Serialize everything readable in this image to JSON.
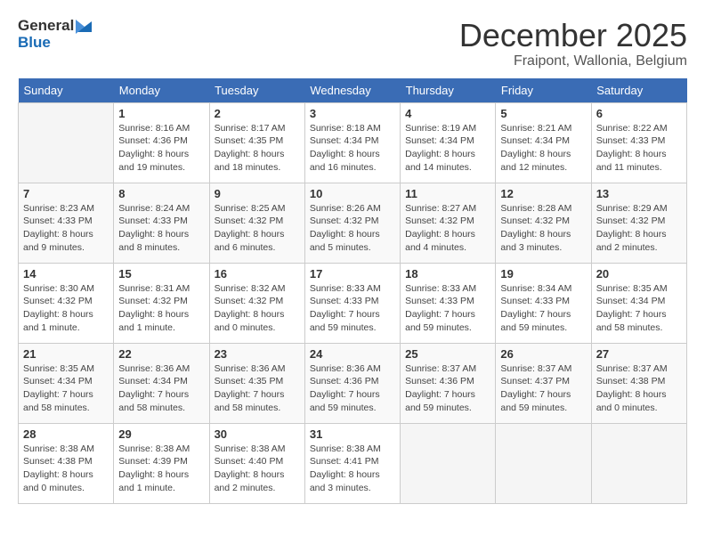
{
  "header": {
    "logo_general": "General",
    "logo_blue": "Blue",
    "month_year": "December 2025",
    "location": "Fraipont, Wallonia, Belgium"
  },
  "days_of_week": [
    "Sunday",
    "Monday",
    "Tuesday",
    "Wednesday",
    "Thursday",
    "Friday",
    "Saturday"
  ],
  "weeks": [
    [
      {
        "day": "",
        "sunrise": "",
        "sunset": "",
        "daylight": ""
      },
      {
        "day": "1",
        "sunrise": "Sunrise: 8:16 AM",
        "sunset": "Sunset: 4:36 PM",
        "daylight": "Daylight: 8 hours and 19 minutes."
      },
      {
        "day": "2",
        "sunrise": "Sunrise: 8:17 AM",
        "sunset": "Sunset: 4:35 PM",
        "daylight": "Daylight: 8 hours and 18 minutes."
      },
      {
        "day": "3",
        "sunrise": "Sunrise: 8:18 AM",
        "sunset": "Sunset: 4:34 PM",
        "daylight": "Daylight: 8 hours and 16 minutes."
      },
      {
        "day": "4",
        "sunrise": "Sunrise: 8:19 AM",
        "sunset": "Sunset: 4:34 PM",
        "daylight": "Daylight: 8 hours and 14 minutes."
      },
      {
        "day": "5",
        "sunrise": "Sunrise: 8:21 AM",
        "sunset": "Sunset: 4:34 PM",
        "daylight": "Daylight: 8 hours and 12 minutes."
      },
      {
        "day": "6",
        "sunrise": "Sunrise: 8:22 AM",
        "sunset": "Sunset: 4:33 PM",
        "daylight": "Daylight: 8 hours and 11 minutes."
      }
    ],
    [
      {
        "day": "7",
        "sunrise": "Sunrise: 8:23 AM",
        "sunset": "Sunset: 4:33 PM",
        "daylight": "Daylight: 8 hours and 9 minutes."
      },
      {
        "day": "8",
        "sunrise": "Sunrise: 8:24 AM",
        "sunset": "Sunset: 4:33 PM",
        "daylight": "Daylight: 8 hours and 8 minutes."
      },
      {
        "day": "9",
        "sunrise": "Sunrise: 8:25 AM",
        "sunset": "Sunset: 4:32 PM",
        "daylight": "Daylight: 8 hours and 6 minutes."
      },
      {
        "day": "10",
        "sunrise": "Sunrise: 8:26 AM",
        "sunset": "Sunset: 4:32 PM",
        "daylight": "Daylight: 8 hours and 5 minutes."
      },
      {
        "day": "11",
        "sunrise": "Sunrise: 8:27 AM",
        "sunset": "Sunset: 4:32 PM",
        "daylight": "Daylight: 8 hours and 4 minutes."
      },
      {
        "day": "12",
        "sunrise": "Sunrise: 8:28 AM",
        "sunset": "Sunset: 4:32 PM",
        "daylight": "Daylight: 8 hours and 3 minutes."
      },
      {
        "day": "13",
        "sunrise": "Sunrise: 8:29 AM",
        "sunset": "Sunset: 4:32 PM",
        "daylight": "Daylight: 8 hours and 2 minutes."
      }
    ],
    [
      {
        "day": "14",
        "sunrise": "Sunrise: 8:30 AM",
        "sunset": "Sunset: 4:32 PM",
        "daylight": "Daylight: 8 hours and 1 minute."
      },
      {
        "day": "15",
        "sunrise": "Sunrise: 8:31 AM",
        "sunset": "Sunset: 4:32 PM",
        "daylight": "Daylight: 8 hours and 1 minute."
      },
      {
        "day": "16",
        "sunrise": "Sunrise: 8:32 AM",
        "sunset": "Sunset: 4:32 PM",
        "daylight": "Daylight: 8 hours and 0 minutes."
      },
      {
        "day": "17",
        "sunrise": "Sunrise: 8:33 AM",
        "sunset": "Sunset: 4:33 PM",
        "daylight": "Daylight: 7 hours and 59 minutes."
      },
      {
        "day": "18",
        "sunrise": "Sunrise: 8:33 AM",
        "sunset": "Sunset: 4:33 PM",
        "daylight": "Daylight: 7 hours and 59 minutes."
      },
      {
        "day": "19",
        "sunrise": "Sunrise: 8:34 AM",
        "sunset": "Sunset: 4:33 PM",
        "daylight": "Daylight: 7 hours and 59 minutes."
      },
      {
        "day": "20",
        "sunrise": "Sunrise: 8:35 AM",
        "sunset": "Sunset: 4:34 PM",
        "daylight": "Daylight: 7 hours and 58 minutes."
      }
    ],
    [
      {
        "day": "21",
        "sunrise": "Sunrise: 8:35 AM",
        "sunset": "Sunset: 4:34 PM",
        "daylight": "Daylight: 7 hours and 58 minutes."
      },
      {
        "day": "22",
        "sunrise": "Sunrise: 8:36 AM",
        "sunset": "Sunset: 4:34 PM",
        "daylight": "Daylight: 7 hours and 58 minutes."
      },
      {
        "day": "23",
        "sunrise": "Sunrise: 8:36 AM",
        "sunset": "Sunset: 4:35 PM",
        "daylight": "Daylight: 7 hours and 58 minutes."
      },
      {
        "day": "24",
        "sunrise": "Sunrise: 8:36 AM",
        "sunset": "Sunset: 4:36 PM",
        "daylight": "Daylight: 7 hours and 59 minutes."
      },
      {
        "day": "25",
        "sunrise": "Sunrise: 8:37 AM",
        "sunset": "Sunset: 4:36 PM",
        "daylight": "Daylight: 7 hours and 59 minutes."
      },
      {
        "day": "26",
        "sunrise": "Sunrise: 8:37 AM",
        "sunset": "Sunset: 4:37 PM",
        "daylight": "Daylight: 7 hours and 59 minutes."
      },
      {
        "day": "27",
        "sunrise": "Sunrise: 8:37 AM",
        "sunset": "Sunset: 4:38 PM",
        "daylight": "Daylight: 8 hours and 0 minutes."
      }
    ],
    [
      {
        "day": "28",
        "sunrise": "Sunrise: 8:38 AM",
        "sunset": "Sunset: 4:38 PM",
        "daylight": "Daylight: 8 hours and 0 minutes."
      },
      {
        "day": "29",
        "sunrise": "Sunrise: 8:38 AM",
        "sunset": "Sunset: 4:39 PM",
        "daylight": "Daylight: 8 hours and 1 minute."
      },
      {
        "day": "30",
        "sunrise": "Sunrise: 8:38 AM",
        "sunset": "Sunset: 4:40 PM",
        "daylight": "Daylight: 8 hours and 2 minutes."
      },
      {
        "day": "31",
        "sunrise": "Sunrise: 8:38 AM",
        "sunset": "Sunset: 4:41 PM",
        "daylight": "Daylight: 8 hours and 3 minutes."
      },
      {
        "day": "",
        "sunrise": "",
        "sunset": "",
        "daylight": ""
      },
      {
        "day": "",
        "sunrise": "",
        "sunset": "",
        "daylight": ""
      },
      {
        "day": "",
        "sunrise": "",
        "sunset": "",
        "daylight": ""
      }
    ]
  ]
}
